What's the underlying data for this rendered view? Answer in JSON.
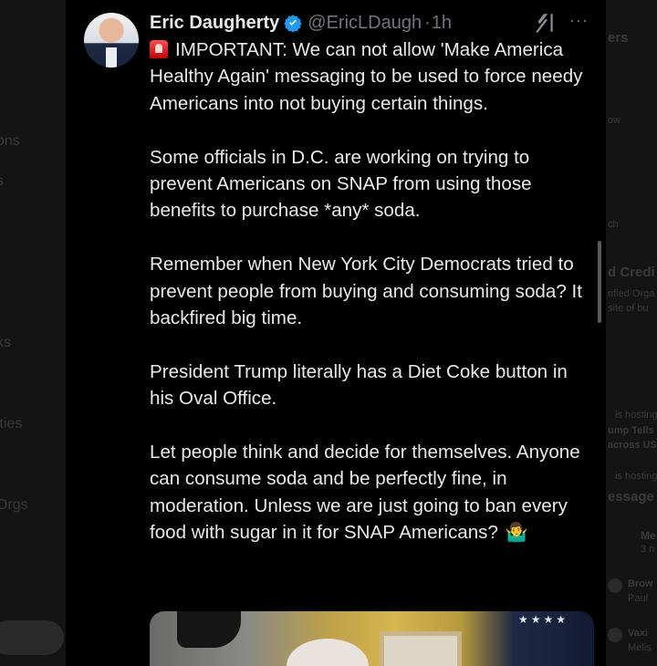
{
  "background": {
    "left_nav": [
      "ons",
      "s",
      "ks",
      "ities",
      "Orgs"
    ],
    "right_snippets": [
      "ers",
      "ow",
      "ch",
      "d Credi",
      "rified Orga",
      "site of bu",
      "is hosting",
      "ump Tells",
      "across US",
      "is hosting",
      "essage",
      "Me",
      "3 n",
      "Brow",
      "Paul",
      "Vaxi",
      "Melis"
    ]
  },
  "tweet": {
    "author_name": "Eric Daugherty",
    "handle": "@EricLDaugh",
    "separator": "·",
    "time": "1h",
    "more_label": "···",
    "paragraphs": [
      "IMPORTANT: We can not allow 'Make America Healthy Again' messaging to be used to force needy Americans into not buying certain things.",
      "Some officials in D.C. are working on trying to prevent Americans on SNAP from using those benefits to purchase *any* soda.",
      "Remember when New York City Democrats tried to prevent people from buying and consuming soda? It backfired big time.",
      "President Trump literally has a Diet Coke button in his Oval Office.",
      "Let people think and decide for themselves. Anyone can consume soda and be perfectly fine, in moderation. Unless we are just going to ban every food with sugar in it for SNAP Americans?"
    ],
    "emoji_end": "🤷‍♂️",
    "icons": {
      "verified": "verified-badge-icon",
      "siren": "siren-emoji-icon",
      "grok": "grok-icon",
      "more": "more-icon"
    }
  },
  "colors": {
    "panel_bg": "#000000",
    "text": "#e7e9ea",
    "muted": "#71767b",
    "verified": "#1d9bf0"
  }
}
